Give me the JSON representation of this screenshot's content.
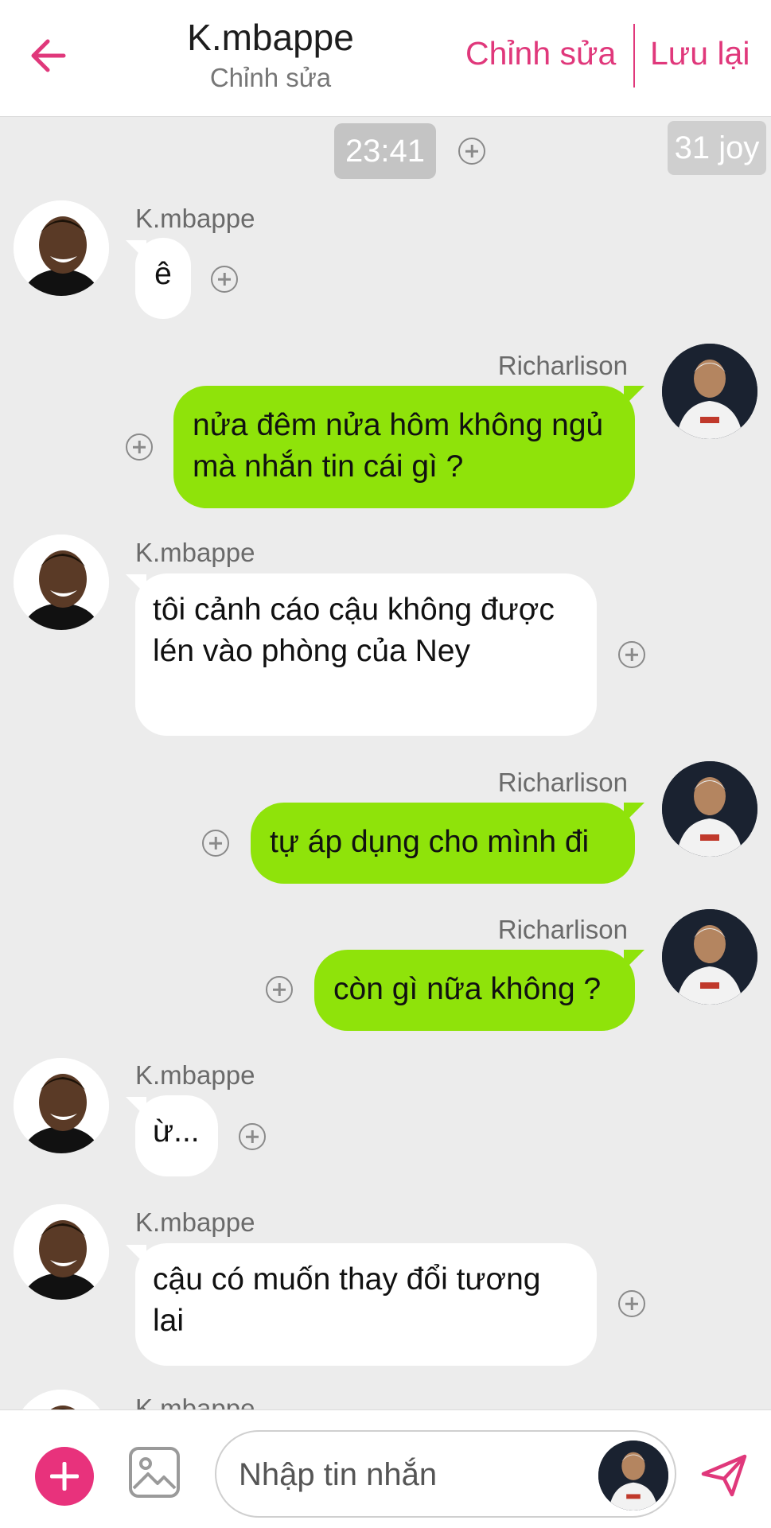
{
  "header": {
    "title": "K.mbappe",
    "subtitle": "Chỉnh sửa",
    "edit_label": "Chỉnh sửa",
    "save_label": "Lưu lại",
    "accent_color": "#e0387b"
  },
  "chat": {
    "time": "23:41",
    "joy_badge": "31 joy",
    "messages": [
      {
        "side": "left",
        "sender": "K.mbappe",
        "text": "ê"
      },
      {
        "side": "right",
        "sender": "Richarlison",
        "text": "nửa đêm nửa hôm không ngủ mà nhắn tin cái gì ?"
      },
      {
        "side": "left",
        "sender": "K.mbappe",
        "text": "tôi cảnh cáo cậu không được lén vào phòng của Ney"
      },
      {
        "side": "right",
        "sender": "Richarlison",
        "text": "tự áp dụng cho mình đi"
      },
      {
        "side": "right",
        "sender": "Richarlison",
        "text": "còn gì nữa không ?"
      },
      {
        "side": "left",
        "sender": "K.mbappe",
        "text": "ừ..."
      },
      {
        "side": "left",
        "sender": "K.mbappe",
        "text": "cậu có muốn thay đổi tương lai"
      },
      {
        "side": "left",
        "sender": "K.mbappe",
        "text": ""
      }
    ],
    "right_bubble_color": "#8fe30a",
    "left_bubble_color": "#ffffff"
  },
  "composer": {
    "placeholder": "Nhập tin nhắn",
    "plus_color": "#e8327c"
  }
}
